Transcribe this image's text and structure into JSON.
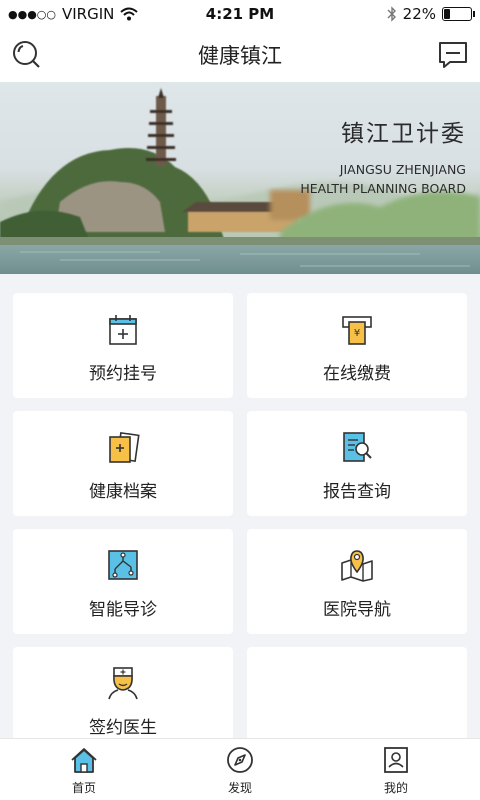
{
  "status_bar": {
    "signal_dots": "●●●○○",
    "carrier": "VIRGIN",
    "time": "4:21 PM",
    "battery_percent": "22%",
    "battery_level": 0.22
  },
  "nav": {
    "title": "健康镇江",
    "left_icon": "search-icon",
    "right_icon": "message-icon"
  },
  "banner": {
    "title_cn": "镇江卫计委",
    "title_en_line1": "JIANGSU ZHENJIANG",
    "title_en_line2": "HEALTH PLANNING BOARD"
  },
  "menu": [
    {
      "label": "预约挂号",
      "icon": "calendar-add-icon"
    },
    {
      "label": "在线缴费",
      "icon": "payment-icon"
    },
    {
      "label": "健康档案",
      "icon": "health-record-icon"
    },
    {
      "label": "报告查询",
      "icon": "report-search-icon"
    },
    {
      "label": "智能导诊",
      "icon": "smart-guide-icon"
    },
    {
      "label": "医院导航",
      "icon": "map-pin-icon"
    },
    {
      "label": "签约医生",
      "icon": "doctor-icon"
    },
    {
      "label": "",
      "icon": ""
    }
  ],
  "tabs": [
    {
      "label": "首页",
      "icon": "home-icon",
      "active": true
    },
    {
      "label": "发现",
      "icon": "compass-icon",
      "active": false
    },
    {
      "label": "我的",
      "icon": "profile-icon",
      "active": false
    }
  ],
  "colors": {
    "accent_blue": "#5bc0e6",
    "accent_yellow": "#f7c046",
    "line": "#333333"
  }
}
